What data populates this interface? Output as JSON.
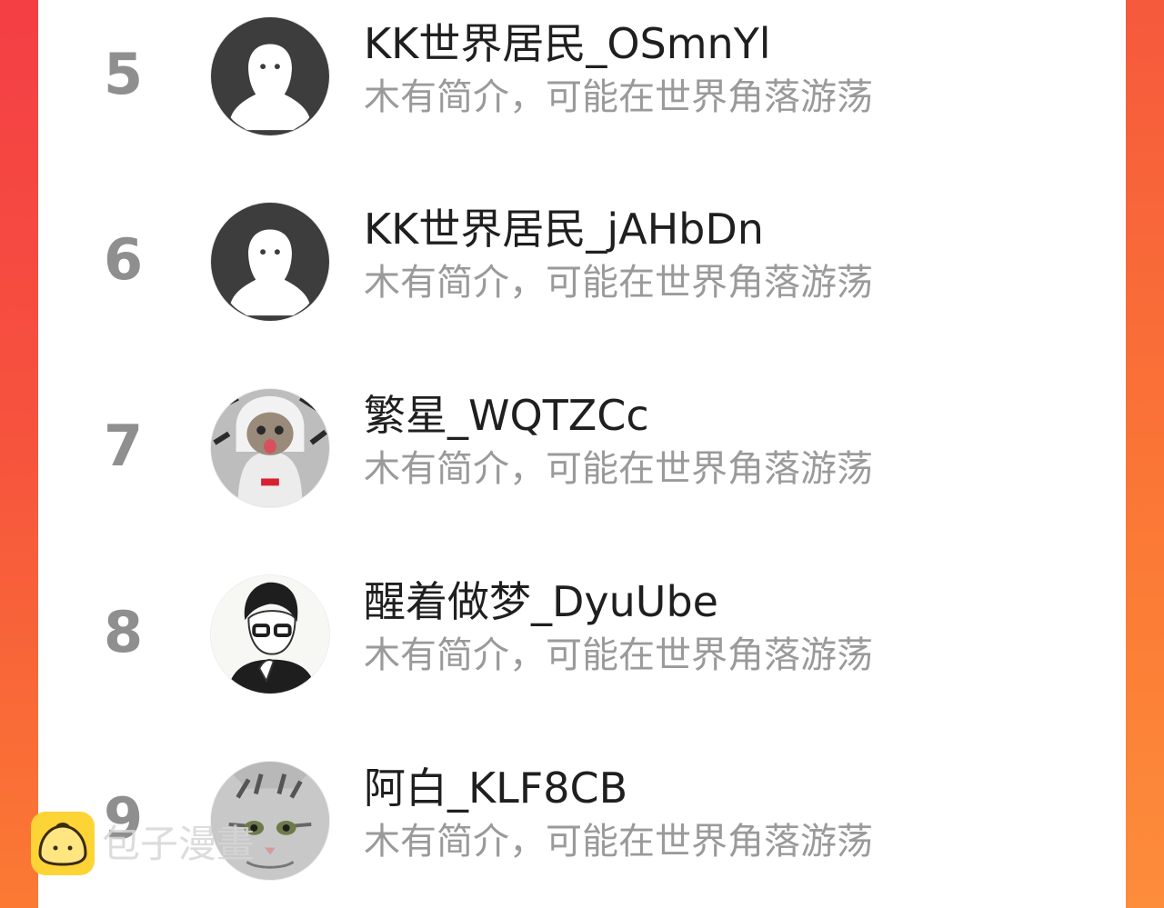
{
  "users": [
    {
      "rank": "5",
      "name": "KK世界居民_OSmnYl",
      "bio": "木有简介，可能在世界角落游荡",
      "avatar": "default-avatar"
    },
    {
      "rank": "6",
      "name": "KK世界居民_jAHbDn",
      "bio": "木有简介，可能在世界角落游荡",
      "avatar": "default-avatar"
    },
    {
      "rank": "7",
      "name": "繁星_WQTZCc",
      "bio": "木有简介，可能在世界角落游荡",
      "avatar": "cat-in-hoodie-photo"
    },
    {
      "rank": "8",
      "name": "醒着做梦_DyuUbe",
      "bio": "木有简介，可能在世界角落游荡",
      "avatar": "anime-boy-with-glasses-drawing"
    },
    {
      "rank": "9",
      "name": "阿白_KLF8CB",
      "bio": "木有简介，可能在世界角落游荡",
      "avatar": "tabby-cat-photo"
    }
  ],
  "watermark": {
    "text": "包子漫畫",
    "icon": "bun-logo-icon"
  },
  "colors": {
    "accent_left": "#f43f45",
    "accent_right": "#fb7a33",
    "rank": "#8f8f8f",
    "bio": "#9a9a9a"
  }
}
